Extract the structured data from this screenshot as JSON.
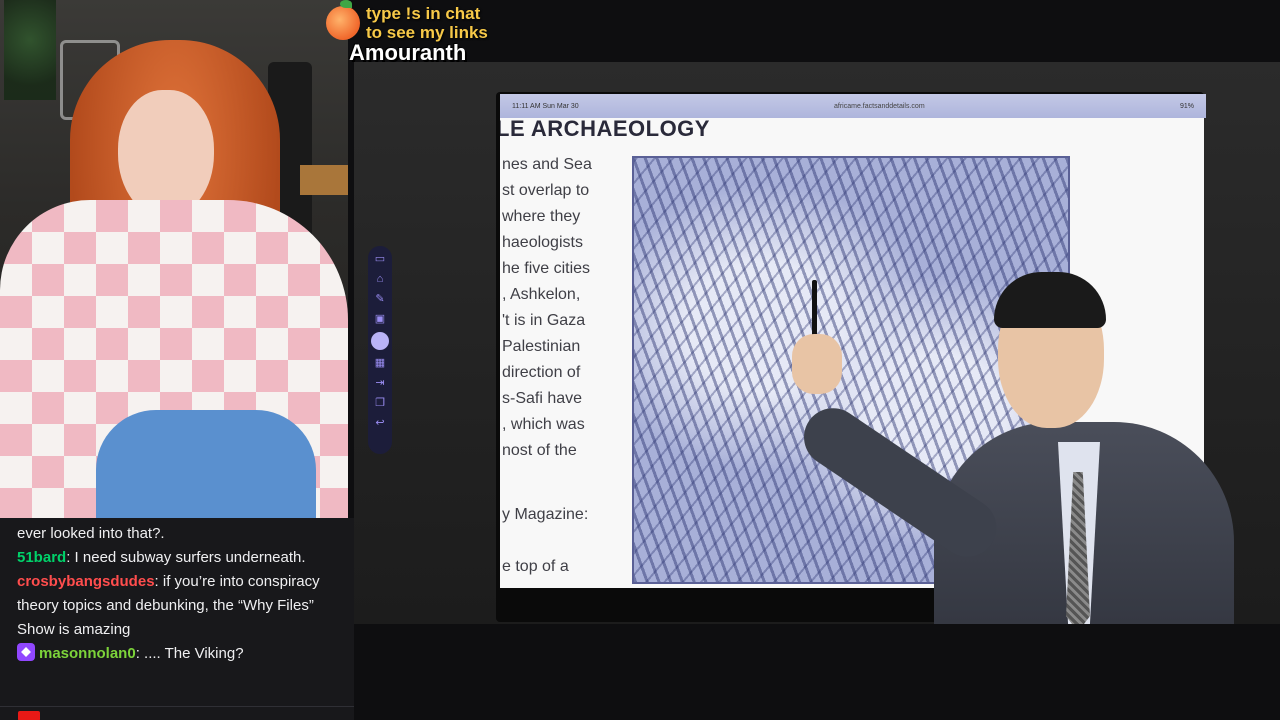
{
  "overlay": {
    "promo_line1": "type !s in chat",
    "promo_line2": "to see my links",
    "streamer": "Amouranth"
  },
  "tablet": {
    "time": "11:11 AM   Sun Mar 30",
    "url": "africame.factsanddetails.com",
    "battery": "91%"
  },
  "document": {
    "heading": "LE ARCHAEOLOGY",
    "lines": [
      "nes and Sea",
      "st overlap to",
      "where they",
      "haeologists",
      "he five cities",
      ", Ashkelon,",
      "'t is in Gaza",
      "Palestinian",
      "direction of",
      "s-Safi have",
      ", which was",
      "nost of the",
      "",
      "y Magazine:",
      "",
      "e top of a"
    ]
  },
  "toolbar": {
    "icons": [
      "chat-icon",
      "home-icon",
      "edit-icon",
      "message-icon",
      "circle-icon",
      "grid-icon",
      "login-icon",
      "layers-icon",
      "undo-icon"
    ]
  },
  "chat": {
    "messages": [
      {
        "user": "",
        "color": "#efeff1",
        "text": "ever looked into that?."
      },
      {
        "user": "51bard",
        "color": "#00d26a",
        "text": "I need subway surfers underneath."
      },
      {
        "user": "crosbybangsdudes",
        "color": "#ff4d4d",
        "text": "if you’re into conspiracy theory topics and debunking, the “Why Files” Show is amazing"
      },
      {
        "user": "masonnolan0",
        "color": "#7cd33a",
        "text": ".... The Viking?",
        "badge": true
      }
    ]
  }
}
